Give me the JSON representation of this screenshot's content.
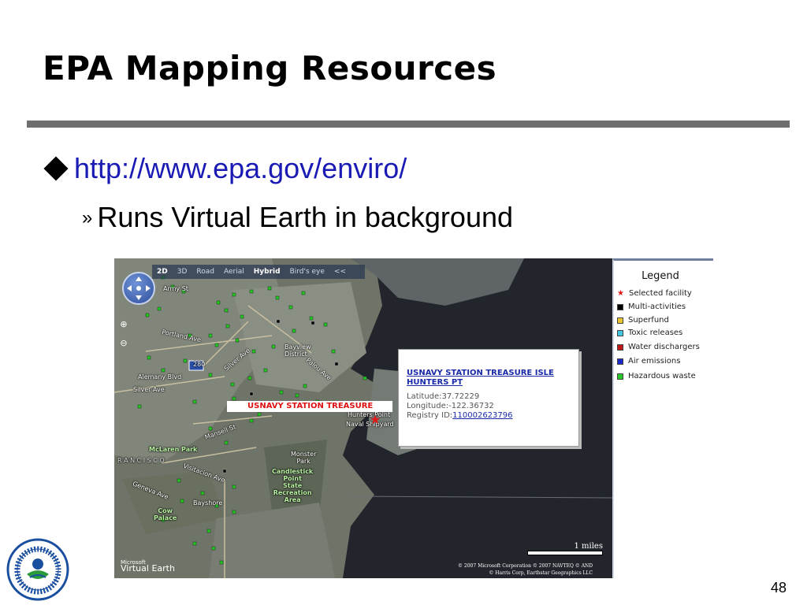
{
  "slide": {
    "title": "EPA Mapping Resources",
    "url": "http://www.epa.gov/enviro/",
    "subpoint": "Runs Virtual Earth in background",
    "page_number": "48"
  },
  "map": {
    "toolbar": [
      "2D",
      "3D",
      "Road",
      "Aerial",
      "Hybrid",
      "Bird's eye",
      "<<"
    ],
    "active_modes": [
      "2D",
      "Hybrid"
    ],
    "zoom_in": "⊕",
    "zoom_out": "⊖",
    "facility_label": "USNAVY STATION TREASURE",
    "labels": {
      "army_st": "Army St",
      "portland_ave": "Portland Ave",
      "alemany": "Alemany Blvd",
      "silver_ave": "Silver Ave",
      "silver_ave2": "Silver Ave",
      "bayview": "Bayview\nDistrict",
      "hunters_point": "Hunters Point",
      "naval_shipyard": "Naval Shipyard",
      "mansell": "Mansell St",
      "mclaren": "McLaren Park",
      "san_francisco": "R  A  N  C  I  S  C  O",
      "monster_park": "Monster\nPark",
      "candlestick": "Candlestick\nPoint\nState\nRecreation\nArea",
      "visitacion": "Visitacion Ave",
      "geneva": "Geneva Ave",
      "bayshore": "Bayshore",
      "cow_palace": "Cow\nPalace",
      "palou": "Palou Ave",
      "i280": "280"
    },
    "popup": {
      "title": "USNAVY STATION TREASURE ISLE HUNTERS PT",
      "latitude": "Latitude:37.72229",
      "longitude": "Longitude:-122.36732",
      "registry_label": "Registry ID:",
      "registry_id": "110002623796"
    },
    "scale": "1 miles",
    "logo_small": "Microsoft",
    "logo_big": "Virtual Earth",
    "copyright_line1": "© 2007 Microsoft Corporation    © 2007 NAVTEQ    © AND",
    "copyright_line2": "© Harris Corp, Earthstar Geographics LLC"
  },
  "legend": {
    "title": "Legend",
    "items": [
      {
        "label": "Selected facility",
        "color": "#e01818",
        "shape": "star"
      },
      {
        "label": "Multi-activities",
        "color": "#000000"
      },
      {
        "label": "Superfund",
        "color": "#e8c630"
      },
      {
        "label": "Toxic releases",
        "color": "#40c8e0"
      },
      {
        "label": "Water dischargers",
        "color": "#c01818"
      },
      {
        "label": "Air emissions",
        "color": "#1a28c8"
      },
      {
        "label": "Hazardous waste",
        "color": "#28c828"
      }
    ]
  }
}
